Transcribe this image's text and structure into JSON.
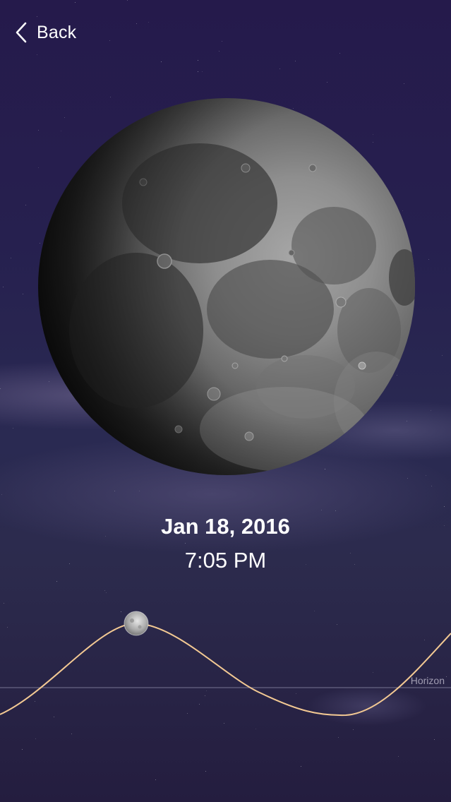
{
  "nav": {
    "back_label": "Back",
    "back_icon": "chevron-left-icon"
  },
  "moon": {
    "image": "moon-phase-waxing-gibbous"
  },
  "datetime": {
    "date": "Jan 18, 2016",
    "time": "7:05 PM"
  },
  "moon_path": {
    "horizon_label": "Horizon",
    "current_position_icon": "moon-position-icon",
    "curve_color": "#f3c993",
    "horizon_color": "#8a8aa6"
  },
  "colors": {
    "background_top": "#251a4b",
    "background_bottom": "#241d3f",
    "text": "#ffffff"
  }
}
